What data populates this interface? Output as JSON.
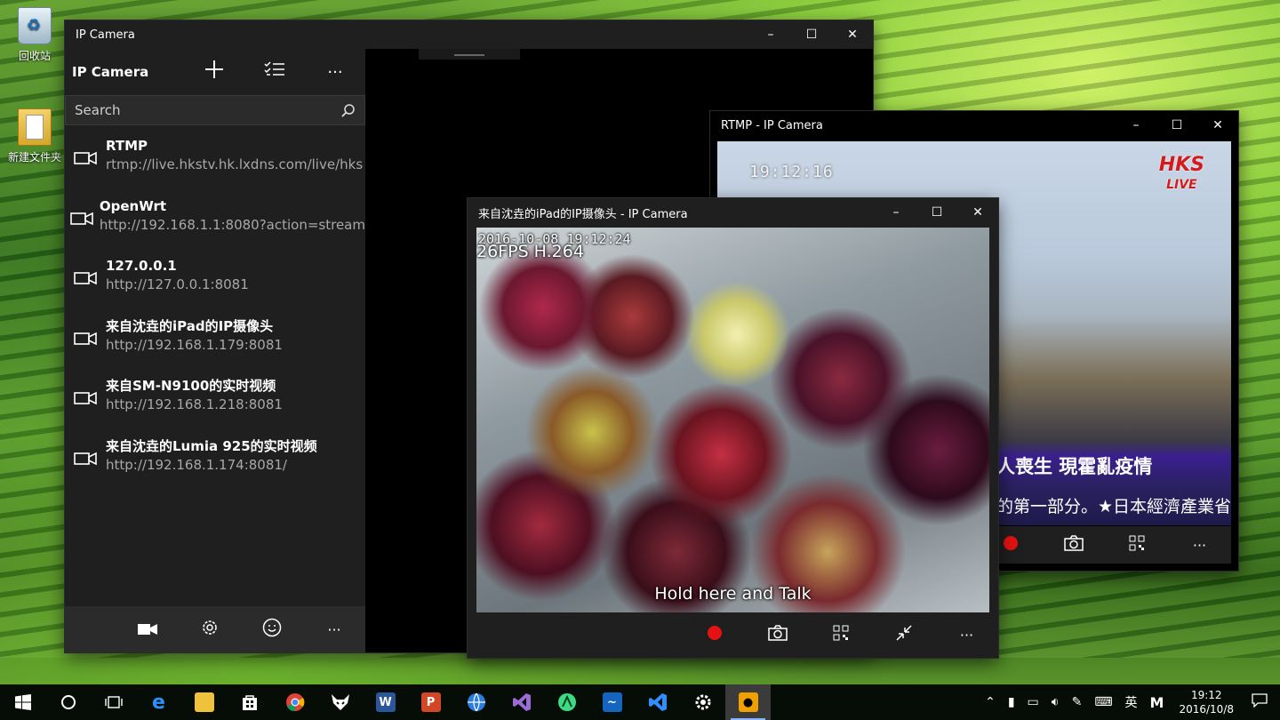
{
  "desktop": {
    "icons": [
      {
        "label": "回收站"
      },
      {
        "label": "新建文件夹"
      }
    ]
  },
  "main_window": {
    "title": "IP Camera",
    "app_name": "IP Camera",
    "search_placeholder": "Search",
    "cameras": [
      {
        "name": "RTMP",
        "url": "rtmp://live.hkstv.hk.lxdns.com/live/hks"
      },
      {
        "name": "OpenWrt",
        "url": "http://192.168.1.1:8080?action=stream"
      },
      {
        "name": "127.0.0.1",
        "url": "http://127.0.0.1:8081"
      },
      {
        "name": "来自沈垚的iPad的IP摄像头",
        "url": "http://192.168.1.179:8081"
      },
      {
        "name": "来自SM-N9100的实时视频",
        "url": "http://192.168.1.218:8081"
      },
      {
        "name": "来自沈垚的Lumia 925的实时视频",
        "url": "http://192.168.1.174:8081/"
      }
    ]
  },
  "rtmp_window": {
    "title": "RTMP - IP Camera",
    "video_time": "19:12:16",
    "logo_top": "HKS",
    "logo_bottom": "LIVE",
    "ticker_line1": "人喪生 現霍亂疫情",
    "ticker_line2": "的第一部分。★日本經濟產業省"
  },
  "ipad_window": {
    "title": "来自沈垚的iPad的IP摄像头 - IP Camera",
    "timestamp": "2016-10-08 19:12:24",
    "stream_info": "26FPS H.264",
    "talk_hint": "Hold here and Talk"
  },
  "taskbar": {
    "time": "19:12",
    "date": "2016/10/8",
    "ime": "英",
    "ime_mode": "M"
  },
  "colors": {
    "record": "#e41212",
    "window_chrome": "#1f1f1f",
    "taskbar": "#060d06"
  }
}
